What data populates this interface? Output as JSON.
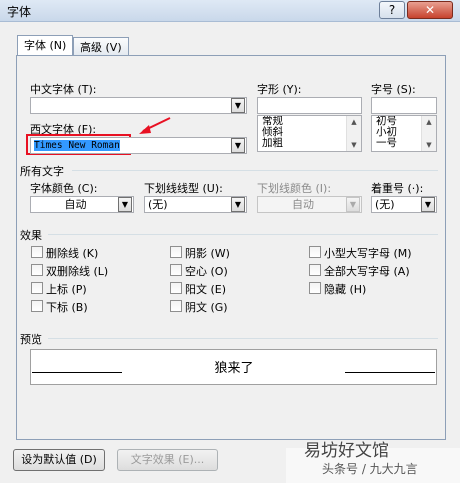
{
  "window": {
    "title": "字体",
    "help_glyph": "?",
    "close_glyph": "✕"
  },
  "tabs": [
    {
      "label": "字体 (N)"
    },
    {
      "label": "高级 (V)"
    }
  ],
  "fields": {
    "chinese_font_label": "中文字体 (T):",
    "chinese_font_value": "",
    "western_font_label": "西文字体 (F):",
    "western_font_value": "Times New Roman",
    "style_label": "字形 (Y):",
    "style_value": "",
    "style_options": [
      "常规",
      "倾斜",
      "加粗"
    ],
    "size_label": "字号 (S):",
    "size_value": "",
    "size_options": [
      "初号",
      "小初",
      "一号"
    ]
  },
  "all_text": {
    "section_label": "所有文字",
    "font_color_label": "字体颜色 (C):",
    "font_color_value": "自动",
    "underline_type_label": "下划线线型 (U):",
    "underline_type_value": "(无)",
    "underline_color_label": "下划线颜色 (I):",
    "underline_color_value": "自动",
    "emphasis_label": "着重号 (·):",
    "emphasis_value": "(无)"
  },
  "effects": {
    "section_label": "效果",
    "items": [
      "删除线 (K)",
      "阴影 (W)",
      "小型大写字母 (M)",
      "双删除线 (L)",
      "空心 (O)",
      "全部大写字母 (A)",
      "上标 (P)",
      "阳文 (E)",
      "隐藏 (H)",
      "下标 (B)",
      "阴文 (G)"
    ]
  },
  "preview": {
    "section_label": "预览",
    "sample_text": "狼来了"
  },
  "buttons": {
    "set_default": "设为默认值 (D)",
    "text_effects": "文字效果 (E)..."
  },
  "watermark": {
    "text": "头条号 / 九大九言",
    "logo_text": "易坊好文馆"
  },
  "colors": {
    "highlight": "#3399ff",
    "annotation_red": "#e81123"
  }
}
